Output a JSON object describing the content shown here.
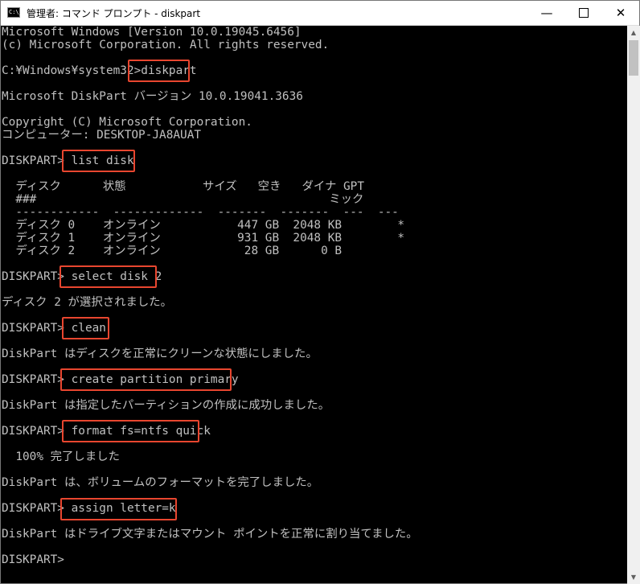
{
  "window": {
    "title": "管理者: コマンド プロンプト - diskpart",
    "minimize_glyph": "—",
    "close_glyph": "✕"
  },
  "scrollbar": {
    "up_glyph": "▲",
    "down_glyph": "▼"
  },
  "console": {
    "lines": [
      "Microsoft Windows [Version 10.0.19045.6456]",
      "(c) Microsoft Corporation. All rights reserved.",
      "",
      "C:¥Windows¥system32>diskpart",
      "",
      "Microsoft DiskPart バージョン 10.0.19041.3636",
      "",
      "Copyright (C) Microsoft Corporation.",
      "コンピューター: DESKTOP-JA8AUAT",
      "",
      "DISKPART> list disk",
      "",
      "  ディスク      状態           サイズ   空き   ダイナ GPT",
      "  ###                                          ミック",
      "  ------------  -------------  -------  -------  ---  ---",
      "  ディスク 0    オンライン           447 GB  2048 KB        *",
      "  ディスク 1    オンライン           931 GB  2048 KB        *",
      "  ディスク 2    オンライン            28 GB      0 B",
      "",
      "DISKPART> select disk 2",
      "",
      "ディスク 2 が選択されました。",
      "",
      "DISKPART> clean",
      "",
      "DiskPart はディスクを正常にクリーンな状態にしました。",
      "",
      "DISKPART> create partition primary",
      "",
      "DiskPart は指定したパーティションの作成に成功しました。",
      "",
      "DISKPART> format fs=ntfs quick",
      "",
      "  100% 完了しました",
      "",
      "DiskPart は、ボリュームのフォーマットを完了しました。",
      "",
      "DISKPART> assign letter=k",
      "",
      "DiskPart はドライブ文字またはマウント ポイントを正常に割り当てました。",
      "",
      "DISKPART>"
    ]
  }
}
